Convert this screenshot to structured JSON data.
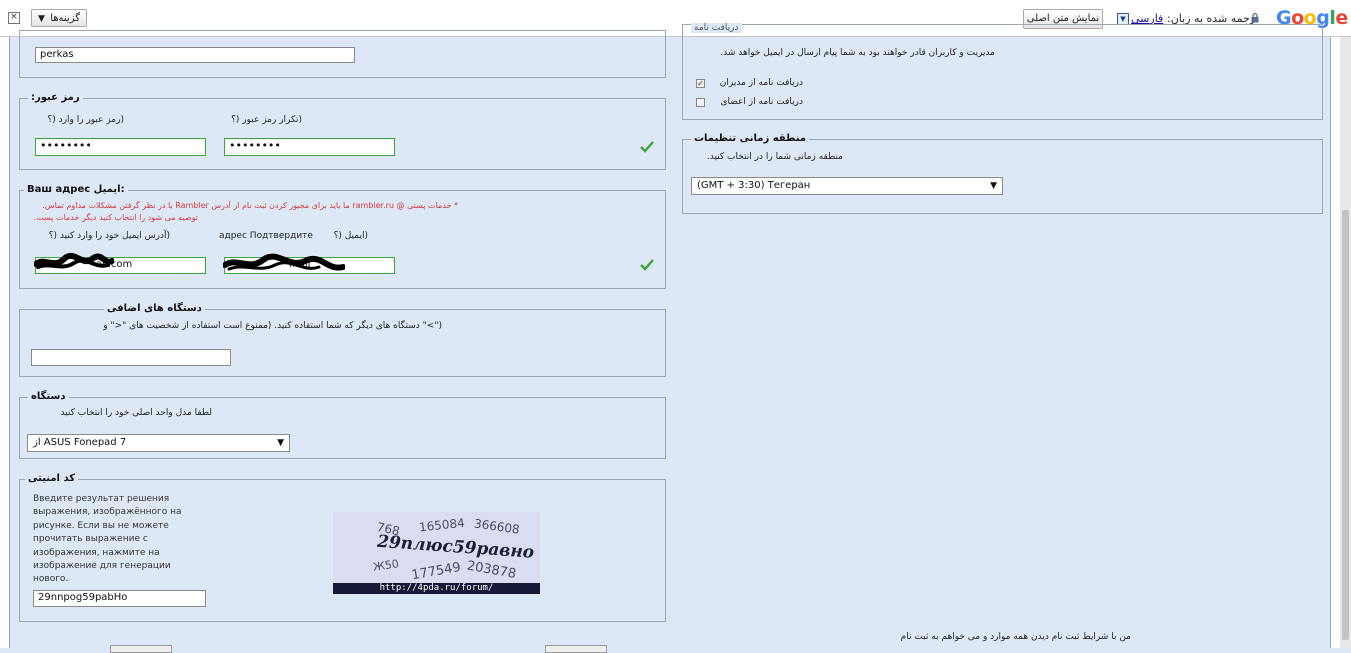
{
  "toolbar": {
    "close": "×",
    "options_label": "گزینه‌ها",
    "options_arrow": "▼",
    "show_original": "نمایش متن اصلی",
    "translated_to": "ترجمه شده به زبان:",
    "language": "فارسی",
    "logo": "Google",
    "logo_colors": [
      "#4285F4",
      "#EA4335",
      "#FBBC05",
      "#4285F4",
      "#34A853",
      "#EA4335"
    ]
  },
  "left": {
    "login": {
      "value": "perkas"
    },
    "password": {
      "legend": ":رمز عبور",
      "label_enter": "(رمز عبور را وارد   (؟",
      "label_repeat": "(تکرار رمز عبور   (؟",
      "value1": "••••••••",
      "value2": "••••••••"
    },
    "email": {
      "legend": "Ваш адрес ایمیل:",
      "notice_line1": "* خدمات پستی @ rambler.ru ما باید برای مجبور کردن ثبت نام از آدرس Rambler با در نظر گرفتن مشکلات مداوم تماس.",
      "notice_line2": "توصیه می شود را انتخاب کنید دیگر خدمات پست.",
      "label_enter": "(آدرس ایمیل خود را وارد کنید   (؟",
      "label_confirm_ru": "адрес Подтвердите",
      "label_confirm_fa": "(ایمیل   (؟",
      "value1": "ail.com",
      "value2": "mail"
    },
    "devices": {
      "legend": "دستگاه های اضافی",
      "help1": "(\">\" دستگاه های دیگر که شما استفاده کنید. (ممنوع است استفاده از شخصیت های \"<\" و",
      "value": ""
    },
    "device": {
      "legend": "دستگاه",
      "help": "لطفا مدل واحد اصلی خود را انتخاب کنید",
      "selected": "از ASUS Fonepad 7"
    },
    "security": {
      "legend": "کد امنیتی",
      "instructions": "Введите результат решения выражения, изображённого на рисунке. Если вы не можете прочитать выражение с изображения, нажмите на изображение для генерации нового.",
      "value": "29nnpog59pabHo",
      "captcha_text": "29плюс59равно",
      "captcha_url": "http://4pda.ru/forum/",
      "captcha_noise": [
        "768",
        "165084",
        "366608",
        "Ж50",
        "177549",
        "203878"
      ]
    }
  },
  "right": {
    "mail": {
      "legend": "دریافت نامه",
      "help": "مدیریت و کاربران قادر خواهند بود به شما پیام ارسال در ایمیل خواهد شد.",
      "opt_admins": "دریافت نامه از مدیران",
      "opt_members": "دریافت نامه از اعضای",
      "admins_checked": true,
      "members_checked": false
    },
    "timezone": {
      "legend": "منطقه زمانی تنظیمات",
      "help": "منطقه زمانی شما را در انتخاب کنید.",
      "selected": "(GMT + 3:30) Тегеран"
    },
    "terms": "من با شرایط ثبت نام دیدن همه موارد و می خواهم به ثبت نام"
  },
  "icons": {
    "valid": "checkmark-icon",
    "lock": "lock-icon",
    "select_caret": "▼"
  }
}
